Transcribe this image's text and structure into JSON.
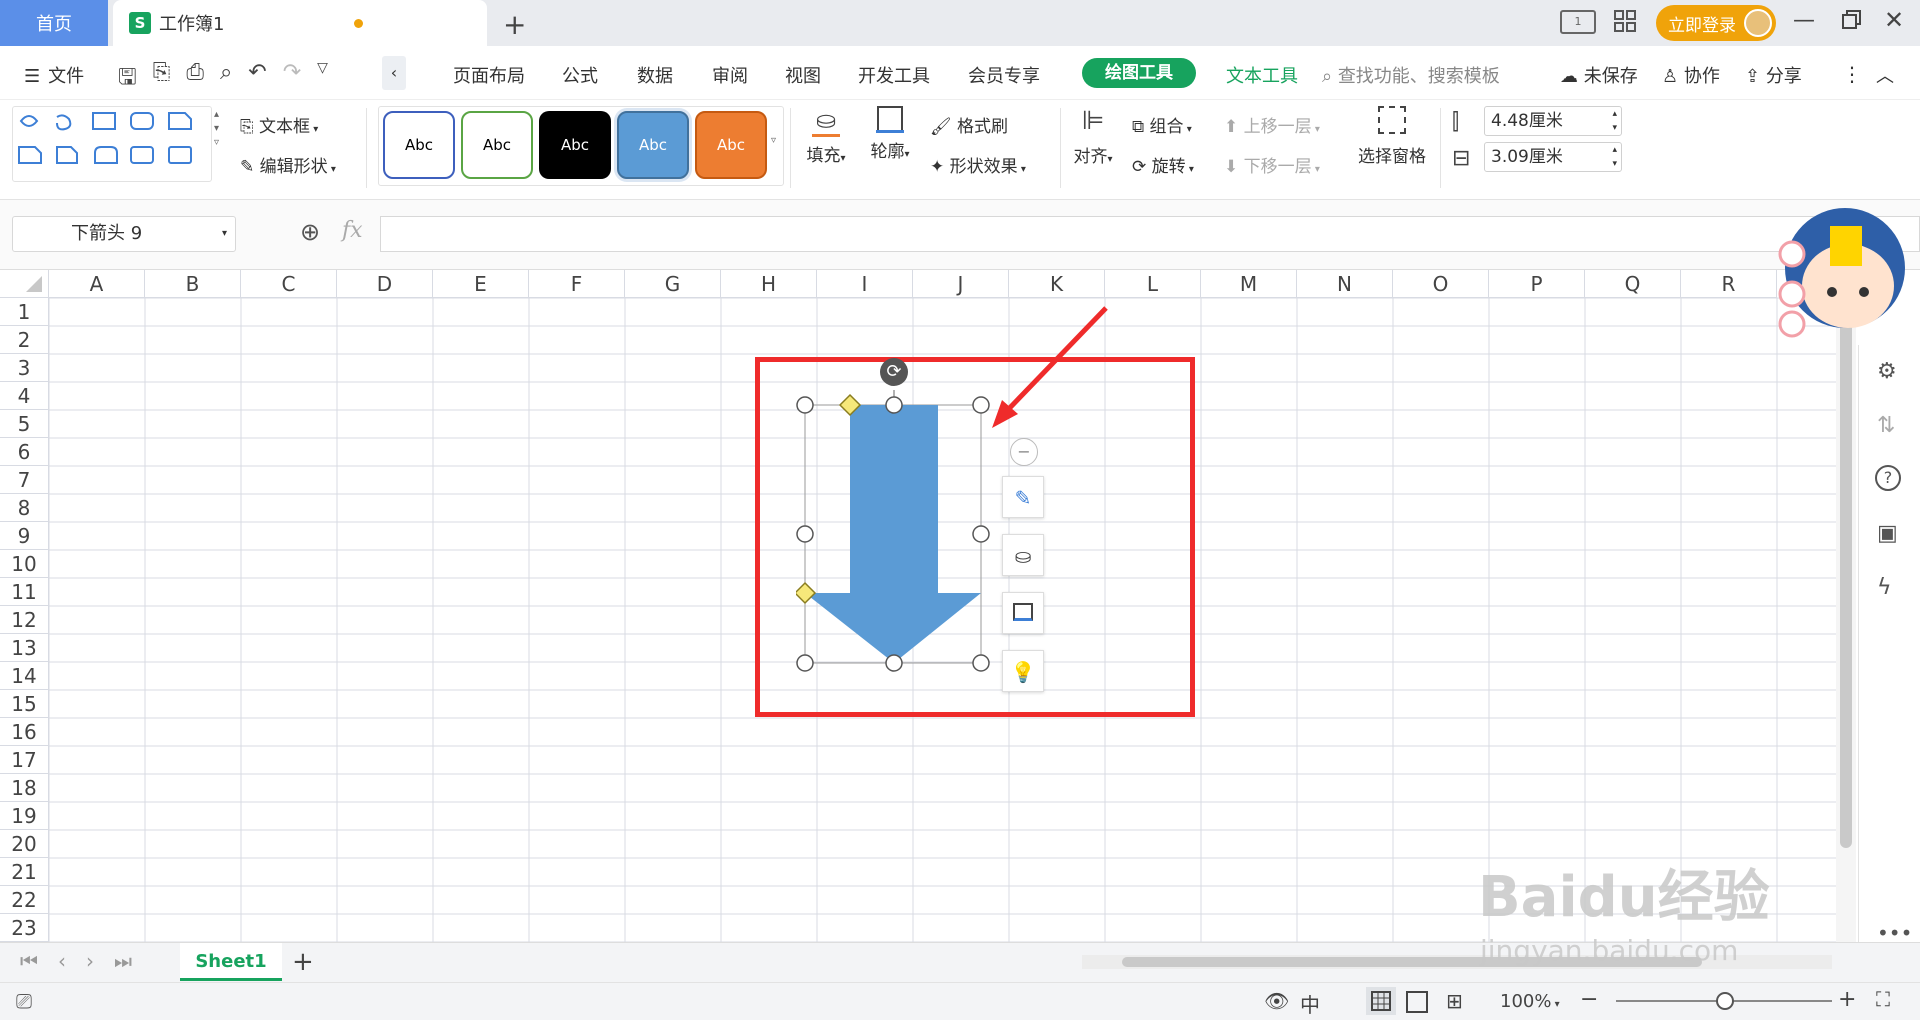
{
  "titlebar": {
    "home_tab": "首页",
    "book_tab": "工作簿1",
    "login_button": "立即登录"
  },
  "menu": {
    "file": "文件",
    "items": [
      "页面布局",
      "公式",
      "数据",
      "审阅",
      "视图",
      "开发工具",
      "会员专享"
    ],
    "drawing_tools": "绘图工具",
    "text_tools": "文本工具",
    "search_placeholder": "查找功能、搜索模板",
    "unsaved": "未保存",
    "collab": "协作",
    "share": "分享"
  },
  "ribbon": {
    "textbox": "文本框",
    "edit_shape": "编辑形状",
    "style_labels": [
      "Abc",
      "Abc",
      "Abc",
      "Abc",
      "Abc"
    ],
    "fill": "填充",
    "outline": "轮廓",
    "format_painter": "格式刷",
    "shape_effect": "形状效果",
    "align": "对齐",
    "group": "组合",
    "rotate": "旋转",
    "bring_forward": "上移一层",
    "send_backward": "下移一层",
    "selection_pane": "选择窗格",
    "width_value": "4.48厘米",
    "height_value": "3.09厘米"
  },
  "formula": {
    "name_box": "下箭头 9",
    "fx": "fx"
  },
  "grid": {
    "columns": [
      "A",
      "B",
      "C",
      "D",
      "E",
      "F",
      "G",
      "H",
      "I",
      "J",
      "K",
      "L",
      "M",
      "N",
      "O",
      "P",
      "Q",
      "R"
    ],
    "rows": [
      "1",
      "2",
      "3",
      "4",
      "5",
      "6",
      "7",
      "8",
      "9",
      "10",
      "11",
      "12",
      "13",
      "14",
      "15",
      "16",
      "17",
      "18",
      "19",
      "20",
      "21",
      "22",
      "23"
    ]
  },
  "sheets": {
    "active": "Sheet1"
  },
  "status": {
    "zoom": "100%"
  },
  "watermark": {
    "brand": "Baidu经验",
    "url": "jingyan.baidu.com"
  },
  "colors": {
    "accent_green": "#17a35e",
    "shape_fill": "#5b9bd5",
    "highlight_red": "#ef2b2b",
    "login_orange": "#f0a30a"
  }
}
